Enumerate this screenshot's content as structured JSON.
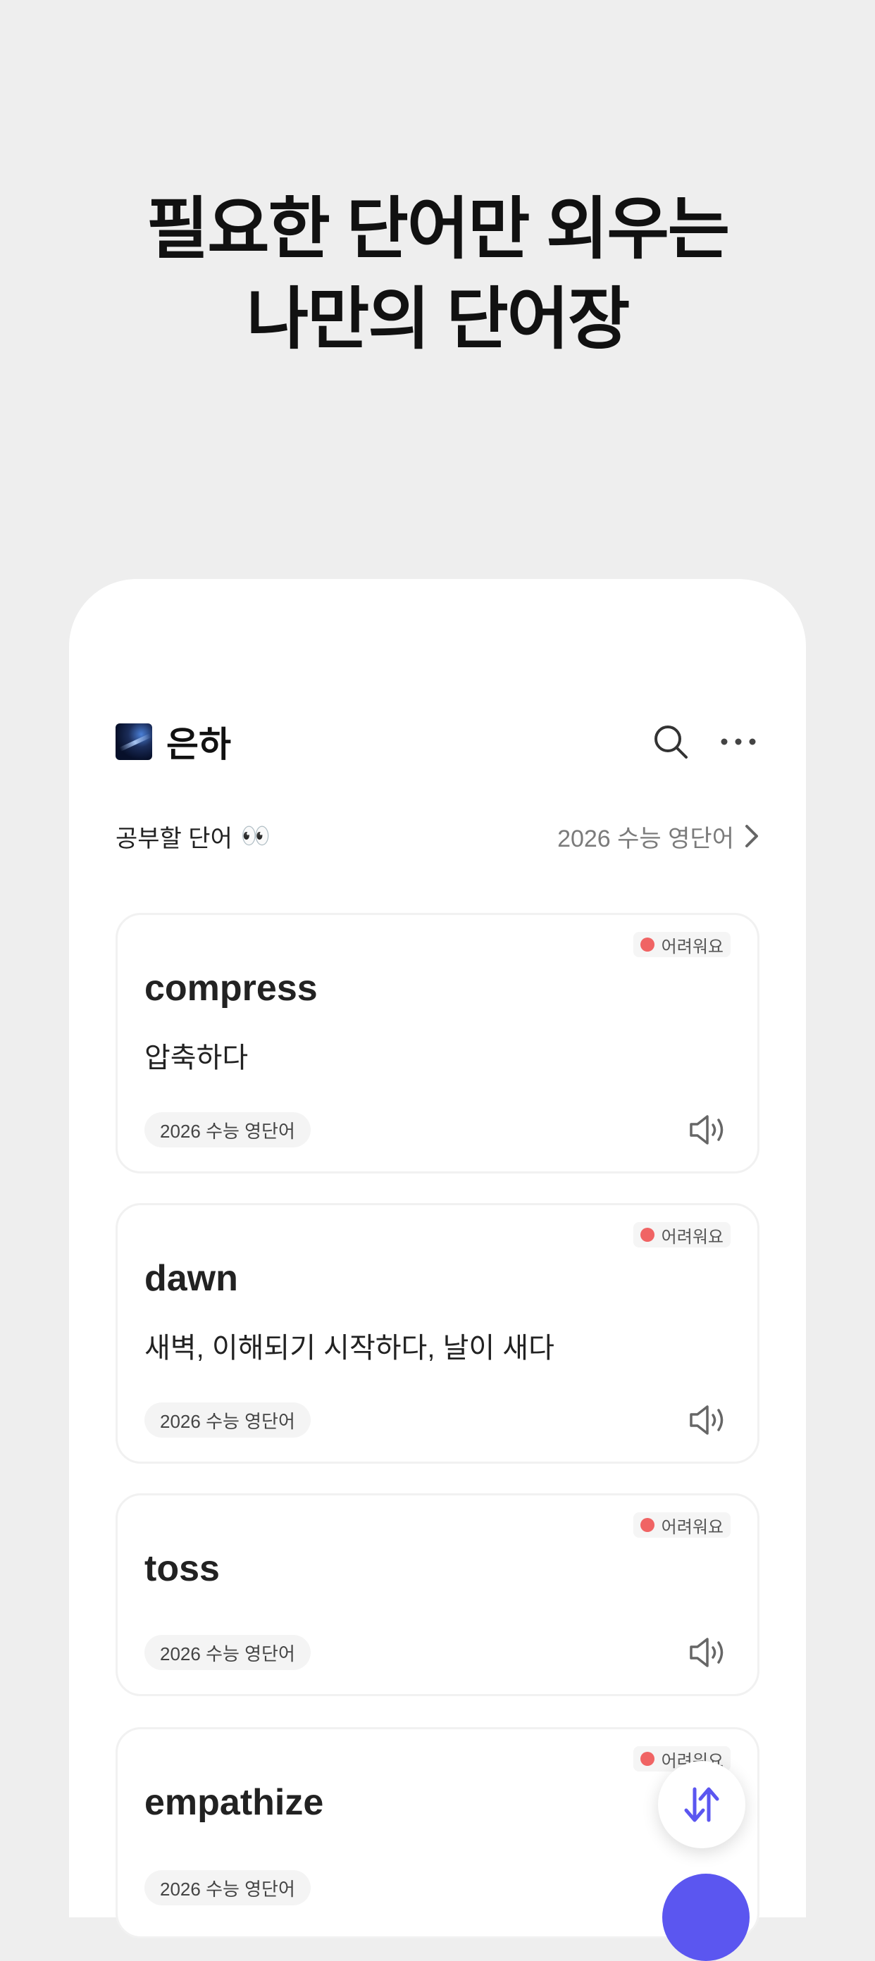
{
  "headline": {
    "line1": "필요한 단어만 외우는",
    "line2": "나만의 단어장"
  },
  "app_bar": {
    "title": "은하",
    "search_icon": "search-icon",
    "more_icon": "more-horizontal-icon"
  },
  "sub_bar": {
    "left_label": "공부할 단어",
    "left_emoji": "👀",
    "right_label": "2026 수능 영단어"
  },
  "cards": [
    {
      "word": "compress",
      "meaning": "압축하다",
      "difficulty": "어려워요",
      "tag": "2026 수능 영단어"
    },
    {
      "word": "dawn",
      "meaning": "새벽, 이해되기 시작하다, 날이 새다",
      "difficulty": "어려워요",
      "tag": "2026 수능 영단어"
    },
    {
      "word": "toss",
      "meaning": "",
      "difficulty": "어려워요",
      "tag": "2026 수능 영단어"
    },
    {
      "word": "empathize",
      "meaning": "",
      "difficulty": "어려워요",
      "tag": "2026 수능 영단어"
    }
  ],
  "colors": {
    "difficulty_dot": "#f06464",
    "fab_accent": "#5b56f0"
  },
  "fab": {
    "icon": "swap-vertical-icon"
  }
}
